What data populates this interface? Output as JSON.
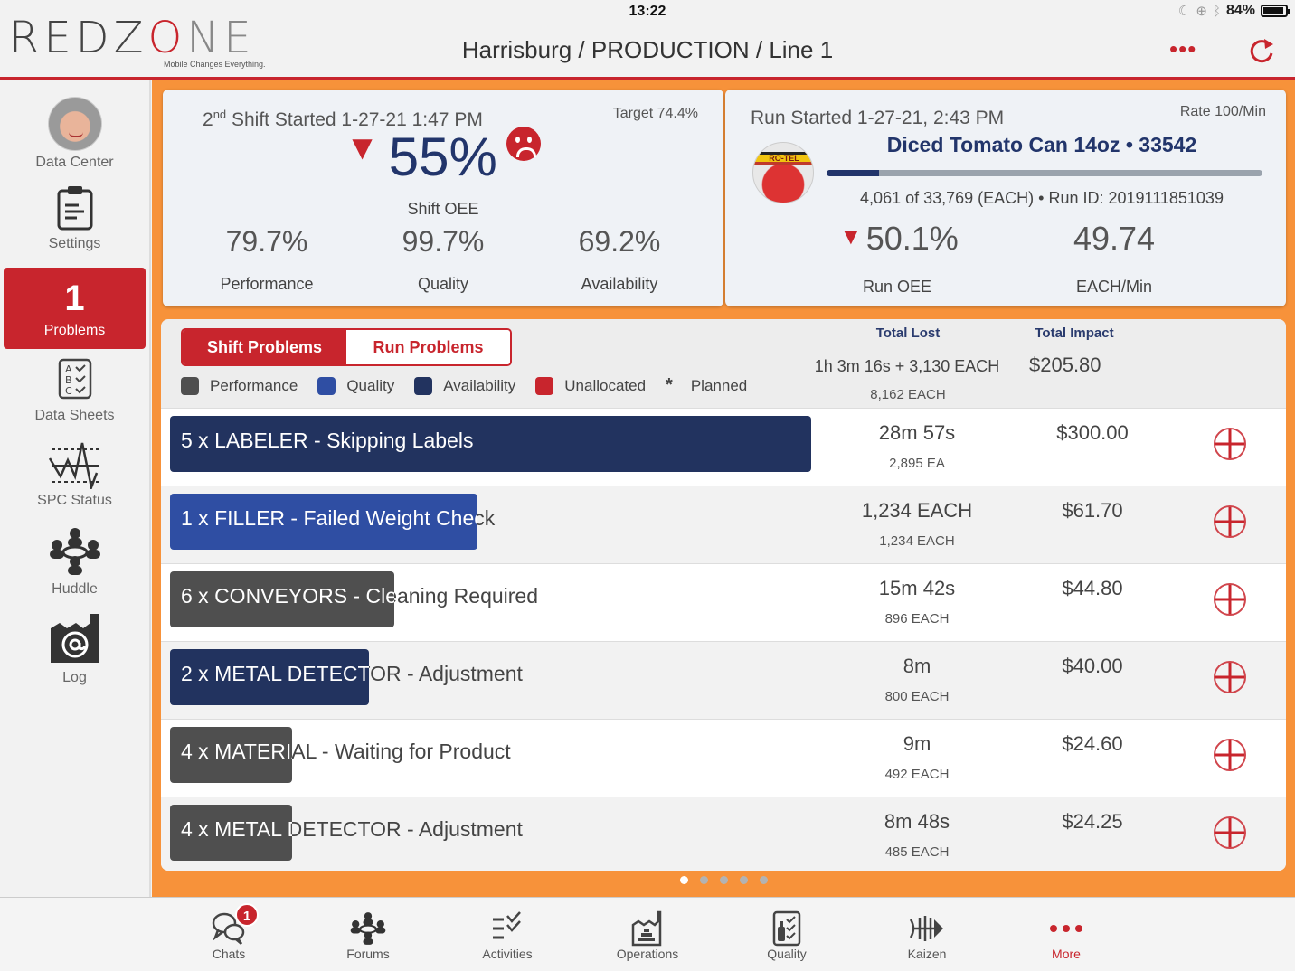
{
  "status_bar": {
    "time": "13:22",
    "battery": "84%",
    "icons": [
      "moon-icon",
      "orientation-lock-icon",
      "bluetooth-icon",
      "battery-icon"
    ]
  },
  "header": {
    "logo_text_a": "REDZ",
    "logo_text_o": "O",
    "logo_text_b": "NE",
    "logo_tagline": "Mobile Changes Everything.",
    "breadcrumb": "Harrisburg / PRODUCTION / Line 1",
    "more_icon": "ellipsis-icon",
    "refresh_icon": "refresh-icon"
  },
  "sidebar": {
    "items": [
      {
        "label": "Data Center",
        "icon": "avatar"
      },
      {
        "label": "Settings",
        "icon": "clipboard-icon"
      },
      {
        "label": "Problems",
        "count": "1",
        "active": true
      },
      {
        "label": "Data Sheets",
        "icon": "abc-checklist-icon"
      },
      {
        "label": "SPC Status",
        "icon": "spc-chart-icon"
      },
      {
        "label": "Huddle",
        "icon": "huddle-icon"
      },
      {
        "label": "Log",
        "icon": "factory-at-icon"
      }
    ]
  },
  "shift": {
    "ordinal": "2",
    "ordinal_suffix": "nd",
    "started": "Shift Started 1-27-21 1:47 PM",
    "target": "Target 74.4%",
    "oee": "55%",
    "oee_label": "Shift OEE",
    "trend": "down",
    "mood": "sad",
    "metrics": [
      {
        "value": "79.7%",
        "label": "Performance"
      },
      {
        "value": "99.7%",
        "label": "Quality"
      },
      {
        "value": "69.2%",
        "label": "Availability"
      }
    ]
  },
  "run": {
    "started": "Run Started 1-27-21, 2:43 PM",
    "rate": "Rate 100/Min",
    "product_brand": "RO-TEL",
    "product": "Diced Tomato Can 14oz • 33542",
    "progress_done": 4061,
    "progress_total": 33769,
    "count_text": "4,061 of 33,769 (EACH) • Run ID: 2019111851039",
    "oee": "50.1%",
    "oee_label": "Run OEE",
    "rate_value": "49.74",
    "rate_label": "EACH/Min"
  },
  "problems": {
    "tabs": [
      {
        "label": "Shift Problems",
        "active": true
      },
      {
        "label": "Run Problems",
        "active": false
      }
    ],
    "legend": [
      {
        "label": "Performance",
        "color": "#4f4f4f"
      },
      {
        "label": "Quality",
        "color": "#2f4ea3"
      },
      {
        "label": "Availability",
        "color": "#22335f"
      },
      {
        "label": "Unallocated",
        "color": "#c8252d"
      }
    ],
    "planned_marker": "*",
    "planned_label": "Planned",
    "total_lost_header": "Total Lost",
    "total_lost": "1h 3m 16s + 3,130 EACH",
    "total_lost_sub": "8,162 EACH",
    "total_impact_header": "Total Impact",
    "total_impact": "$205.80",
    "rows": [
      {
        "desc": "5 x LABELER - Skipping Labels",
        "category": "Availability",
        "bar_fraction": 1.0,
        "lost": "28m 57s",
        "lost_sub": "2,895 EA",
        "impact": "$300.00"
      },
      {
        "desc": "1 x FILLER - Failed Weight Check",
        "category": "Quality",
        "bar_fraction": 0.48,
        "lost": "1,234 EACH",
        "lost_sub": "1,234 EACH",
        "impact": "$61.70"
      },
      {
        "desc": "6 x CONVEYORS - Cleaning Required",
        "category": "Performance",
        "bar_fraction": 0.35,
        "lost": "15m 42s",
        "lost_sub": "896 EACH",
        "impact": "$44.80"
      },
      {
        "desc": "2 x METAL DETECTOR - Adjustment",
        "category": "Availability",
        "bar_fraction": 0.31,
        "lost": "8m",
        "lost_sub": "800 EACH",
        "impact": "$40.00"
      },
      {
        "desc": "4 x MATERIAL - Waiting for Product",
        "category": "Performance",
        "bar_fraction": 0.19,
        "lost": "9m",
        "lost_sub": "492 EACH",
        "impact": "$24.60"
      },
      {
        "desc": "4 x METAL DETECTOR - Adjustment",
        "category": "Performance",
        "bar_fraction": 0.19,
        "lost": "8m 48s",
        "lost_sub": "485 EACH",
        "impact": "$24.25"
      }
    ]
  },
  "pager": {
    "pages": 5,
    "current": 1
  },
  "tabbar": {
    "items": [
      {
        "label": "Chats",
        "icon": "chat-bubbles-icon",
        "badge": "1"
      },
      {
        "label": "Forums",
        "icon": "forums-icon"
      },
      {
        "label": "Activities",
        "icon": "activities-icon"
      },
      {
        "label": "Operations",
        "icon": "operations-icon"
      },
      {
        "label": "Quality",
        "icon": "quality-icon"
      },
      {
        "label": "Kaizen",
        "icon": "kaizen-icon"
      },
      {
        "label": "More",
        "icon": "more-dots-icon",
        "active": true
      }
    ]
  },
  "colors": {
    "brand_red": "#c8252d",
    "orange": "#f7923a",
    "navy": "#22356b"
  }
}
